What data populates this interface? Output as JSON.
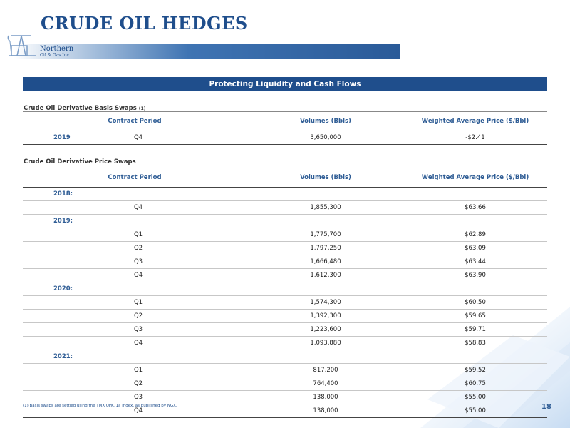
{
  "title": "CRUDE OIL HEDGES",
  "logo": {
    "line1": "Northern",
    "line2": "Oil & Gas Inc."
  },
  "banner": "Protecting Liquidity and Cash Flows",
  "basis": {
    "label": "Crude Oil Derivative Basis Swaps",
    "footnote_ref": "(1)",
    "headers": {
      "period": "Contract Period",
      "volume": "Volumes (Bbls)",
      "price": "Weighted Average Price ($/Bbl)"
    },
    "rows": [
      {
        "year": "2019",
        "period": "Q4",
        "volume": "3,650,000",
        "price": "-$2.41"
      }
    ]
  },
  "price_swaps": {
    "label": "Crude Oil Derivative Price Swaps",
    "headers": {
      "period": "Contract Period",
      "volume": "Volumes (Bbls)",
      "price": "Weighted Average Price ($/Bbl)"
    },
    "groups": [
      {
        "year": "2018:",
        "rows": [
          {
            "period": "Q4",
            "volume": "1,855,300",
            "price": "$63.66"
          }
        ]
      },
      {
        "year": "2019:",
        "rows": [
          {
            "period": "Q1",
            "volume": "1,775,700",
            "price": "$62.89"
          },
          {
            "period": "Q2",
            "volume": "1,797,250",
            "price": "$63.09"
          },
          {
            "period": "Q3",
            "volume": "1,666,480",
            "price": "$63.44"
          },
          {
            "period": "Q4",
            "volume": "1,612,300",
            "price": "$63.90"
          }
        ]
      },
      {
        "year": "2020:",
        "rows": [
          {
            "period": "Q1",
            "volume": "1,574,300",
            "price": "$60.50"
          },
          {
            "period": "Q2",
            "volume": "1,392,300",
            "price": "$59.65"
          },
          {
            "period": "Q3",
            "volume": "1,223,600",
            "price": "$59.71"
          },
          {
            "period": "Q4",
            "volume": "1,093,880",
            "price": "$58.83"
          }
        ]
      },
      {
        "year": "2021:",
        "rows": [
          {
            "period": "Q1",
            "volume": "817,200",
            "price": "$59.52"
          },
          {
            "period": "Q2",
            "volume": "764,400",
            "price": "$60.75"
          },
          {
            "period": "Q3",
            "volume": "138,000",
            "price": "$55.00"
          },
          {
            "period": "Q4",
            "volume": "138,000",
            "price": "$55.00"
          }
        ]
      }
    ]
  },
  "footnote": "(1)  Basis swaps are settled using the TMX UHC 1a index, as published by NGX.",
  "page_number": "18",
  "colors": {
    "primary": "#1f4e8c",
    "header_text": "#2f5d95"
  }
}
